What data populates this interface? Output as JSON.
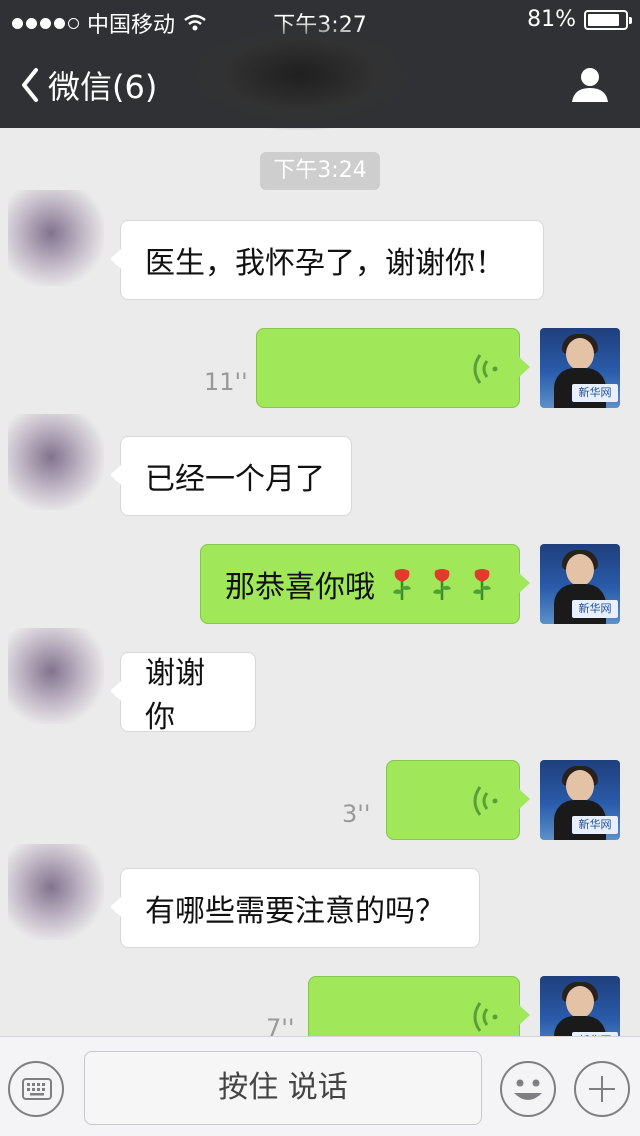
{
  "status_bar": {
    "carrier": "中国移动",
    "time": "下午3:27",
    "battery": "81%",
    "battery_level": 0.81
  },
  "nav": {
    "back_label": "微信(6)"
  },
  "chat": {
    "timestamp": "下午3:24",
    "messages": [
      {
        "side": "in",
        "type": "text",
        "text": "医生，我怀孕了，谢谢你！"
      },
      {
        "side": "out",
        "type": "voice",
        "duration": "11''"
      },
      {
        "side": "in",
        "type": "text",
        "text": "已经一个月了"
      },
      {
        "side": "out",
        "type": "text",
        "text": "那恭喜你哦",
        "emoji": [
          "rose-emoji",
          "rose-emoji",
          "rose-emoji"
        ]
      },
      {
        "side": "in",
        "type": "text",
        "text": "谢谢你"
      },
      {
        "side": "out",
        "type": "voice",
        "duration": "3''"
      },
      {
        "side": "in",
        "type": "text",
        "text": "有哪些需要注意的吗？"
      },
      {
        "side": "out",
        "type": "voice",
        "duration": "7''"
      }
    ],
    "self_avatar_logo": "新华网"
  },
  "input_bar": {
    "hold_to_talk": "按住 说话"
  }
}
